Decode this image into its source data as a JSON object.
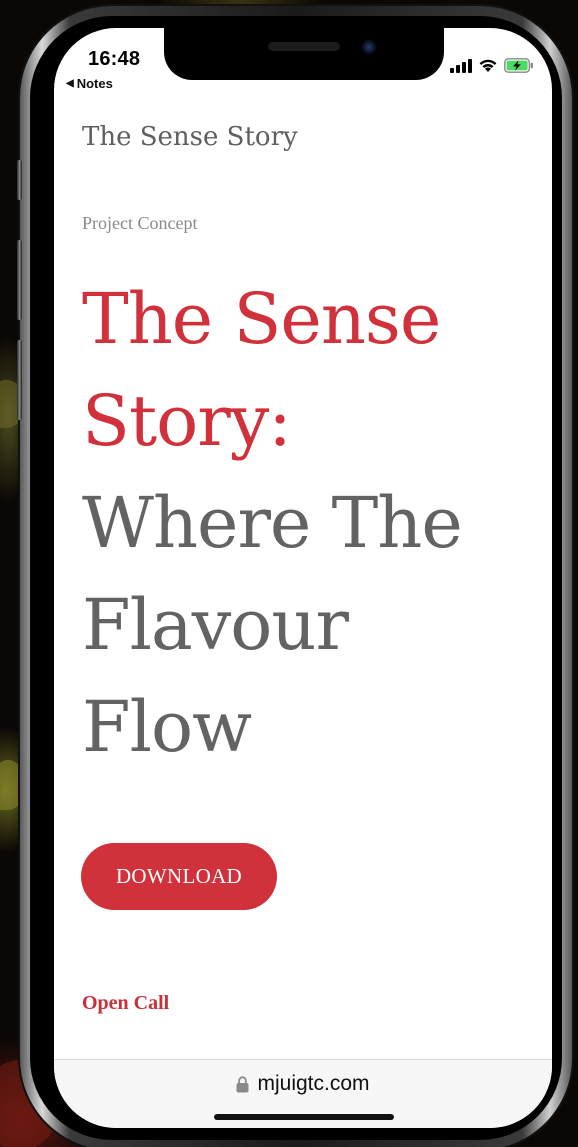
{
  "status_bar": {
    "time": "16:48",
    "back_label": "Notes",
    "icons": [
      "signal-icon",
      "wifi-icon",
      "battery-charging-icon"
    ],
    "battery_color": "#4cd964"
  },
  "site": {
    "title": "The Sense Story"
  },
  "hero": {
    "eyebrow": "Project Concept",
    "headline_red": [
      "The Sense",
      "Story:"
    ],
    "headline_gray": [
      "Where The",
      "Flavour",
      "Flow"
    ],
    "accent_color": "#d0313a",
    "text_color": "#636363"
  },
  "actions": {
    "download_label": "DOWNLOAD",
    "open_call_label": "Open Call"
  },
  "browser": {
    "url": "mjuigtc.com",
    "lock_icon": "lock-icon"
  }
}
